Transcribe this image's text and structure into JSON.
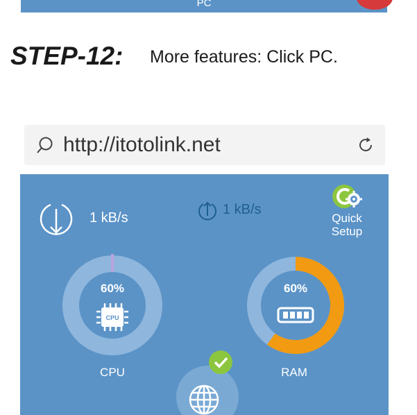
{
  "previous_step": {
    "pc_label": "PC"
  },
  "step": {
    "title": "STEP-12:",
    "instruction": "More features: Click PC."
  },
  "browser": {
    "url": "http://itotolink.net"
  },
  "router_panel": {
    "download_rate": "1 kB/s",
    "upload_rate": "1 kB/s",
    "quick_setup_label": "Quick Setup",
    "cpu": {
      "percent_text": "60%",
      "chip_text": "CPU",
      "label": "CPU",
      "usage": 60
    },
    "ram": {
      "percent_text": "60%",
      "label": "RAM",
      "usage": 60
    }
  },
  "colors": {
    "panel_background": "#5b93c7",
    "gauge_track": "#8fb6dc",
    "ram_arc": "#f19a12",
    "cpu_marker": "#b9a3e0",
    "quick_setup_green": "#8cc63f",
    "check_green": "#8cc63f",
    "upload_text": "#1f5f8f"
  },
  "icons": {
    "search": "search-icon",
    "reload": "reload-icon",
    "download": "download-icon",
    "upload": "upload-icon",
    "quick_setup": "quick-setup-icon",
    "cpu": "cpu-chip-icon",
    "ram": "memory-icon",
    "internet": "globe-icon",
    "status": "check-icon"
  }
}
